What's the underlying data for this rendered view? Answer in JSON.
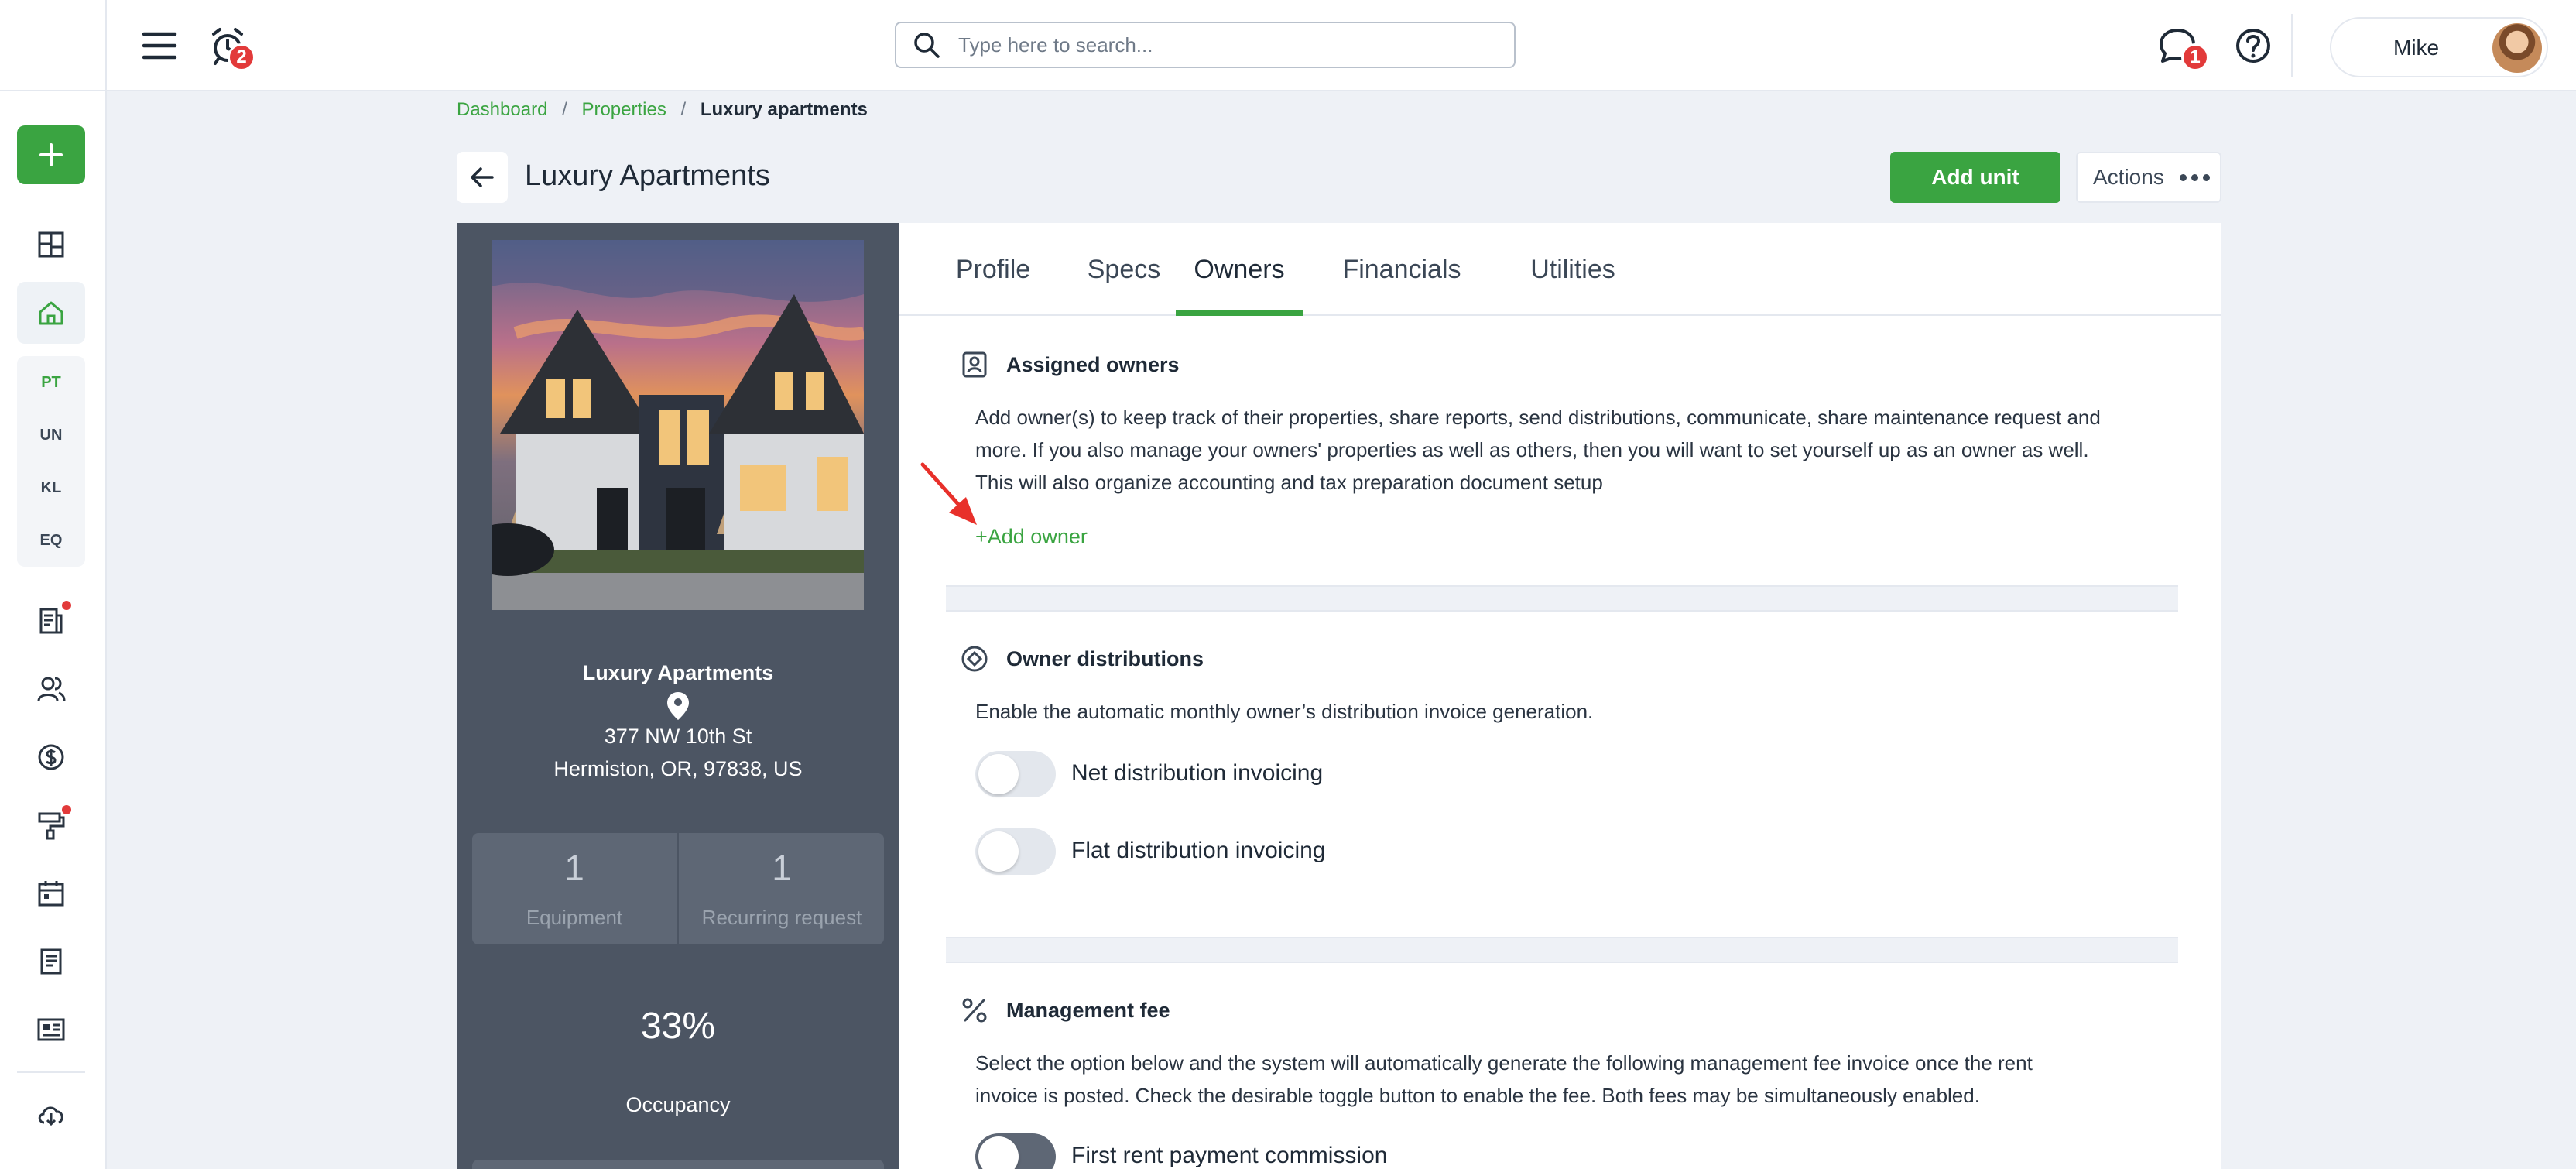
{
  "topbar": {
    "search_placeholder": "Type here to search...",
    "alarm_badge": "2",
    "chat_badge": "1",
    "user_name": "Mike"
  },
  "rail": {
    "sub_items": [
      "PT",
      "UN",
      "KL",
      "EQ"
    ]
  },
  "breadcrumb": {
    "items": [
      "Dashboard",
      "Properties"
    ],
    "current": "Luxury apartments",
    "separator": "/"
  },
  "header": {
    "title": "Luxury Apartments",
    "add_unit_label": "Add unit",
    "actions_label": "Actions"
  },
  "property": {
    "name": "Luxury Apartments",
    "address_line1": "377 NW 10th St",
    "address_line2": "Hermiston, OR, 97838, US",
    "stats": [
      {
        "value": "1",
        "label": "Equipment"
      },
      {
        "value": "1",
        "label": "Recurring request"
      }
    ],
    "occupancy_value": "33%",
    "occupancy_label": "Occupancy"
  },
  "tabs": [
    {
      "label": "Profile"
    },
    {
      "label": "Specs"
    },
    {
      "label": "Owners"
    },
    {
      "label": "Financials"
    },
    {
      "label": "Utilities"
    }
  ],
  "active_tab": "Owners",
  "owners": {
    "assigned": {
      "title": "Assigned owners",
      "lines": [
        "Add owner(s) to keep track of their properties, share reports, send distributions, communicate, share maintenance request and",
        "more. If you also manage your owners' properties as well as others, then you will want to set yourself up as an owner as well.",
        "This will also organize accounting and tax preparation document setup"
      ],
      "add_owner_label": "+Add owner"
    },
    "distributions": {
      "title": "Owner distributions",
      "description": "Enable the automatic monthly owner’s distribution invoice generation.",
      "toggles": [
        {
          "label": "Net distribution invoicing",
          "enabled": false
        },
        {
          "label": "Flat distribution invoicing",
          "enabled": false
        }
      ]
    },
    "management_fee": {
      "title": "Management fee",
      "lines": [
        "Select the option below and the system will automatically generate the following management fee invoice once the rent",
        "invoice is posted. Check the desirable toggle button to enable the fee. Both fees may be simultaneously enabled."
      ],
      "toggles": [
        {
          "label": "First rent payment commission",
          "enabled": false
        }
      ]
    }
  },
  "colors": {
    "accent": "#3aa441",
    "badge": "#e23a3a",
    "panel": "#4c5563",
    "annotation_arrow": "#e8302a"
  }
}
